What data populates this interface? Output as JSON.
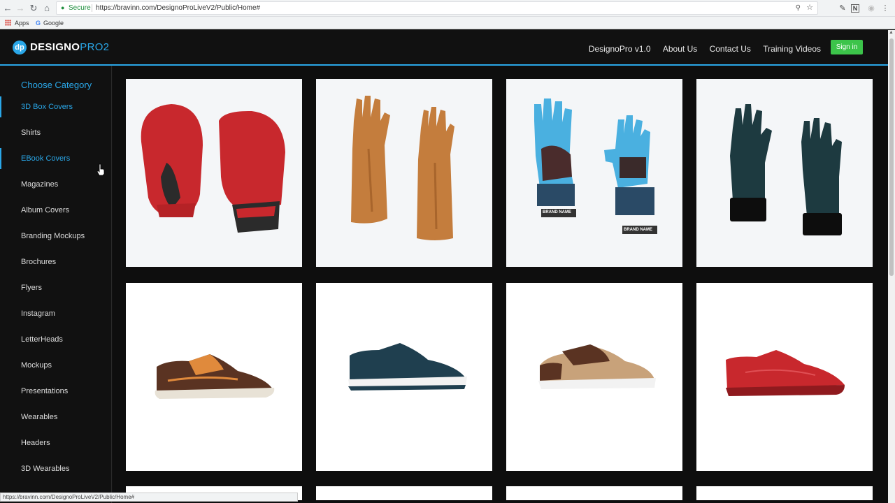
{
  "browser": {
    "secure_label": "Secure",
    "url": "https://bravinn.com/DesignoProLiveV2/Public/Home#",
    "bookmarks": [
      "Apps",
      "Google"
    ],
    "status_url": "https://bravinn.com/DesignoProLiveV2/Public/Home#"
  },
  "header": {
    "logo_main": "DESIGNO",
    "logo_accent": "PRO2",
    "nav": [
      "DesignoPro v1.0",
      "About Us",
      "Contact Us",
      "Training Videos"
    ],
    "signin_label": "Sign in"
  },
  "sidebar": {
    "title": "Choose Category",
    "items": [
      {
        "label": "3D Box Covers",
        "active": true
      },
      {
        "label": "Shirts",
        "active": false
      },
      {
        "label": "EBook Covers",
        "active": true
      },
      {
        "label": "Magazines",
        "active": false
      },
      {
        "label": "Album Covers",
        "active": false
      },
      {
        "label": "Branding Mockups",
        "active": false
      },
      {
        "label": "Brochures",
        "active": false
      },
      {
        "label": "Flyers",
        "active": false
      },
      {
        "label": "Instagram",
        "active": false
      },
      {
        "label": "LetterHeads",
        "active": false
      },
      {
        "label": "Mockups",
        "active": false
      },
      {
        "label": "Presentations",
        "active": false
      },
      {
        "label": "Wearables",
        "active": false
      },
      {
        "label": "Headers",
        "active": false
      },
      {
        "label": "3D Wearables",
        "active": false
      }
    ]
  },
  "grid": {
    "items": [
      {
        "name": "red-boxing-gloves-image"
      },
      {
        "name": "brown-rubber-gloves-image"
      },
      {
        "name": "blue-work-gloves-image",
        "brand_label": "BRAND NAME"
      },
      {
        "name": "dark-leather-gloves-image"
      },
      {
        "name": "brown-sneaker-image"
      },
      {
        "name": "navy-sneaker-image"
      },
      {
        "name": "tan-boat-shoe-image"
      },
      {
        "name": "red-sneaker-image"
      }
    ]
  },
  "colors": {
    "accent": "#2aa7e8",
    "signin": "#3cc44a",
    "background": "#111111"
  }
}
